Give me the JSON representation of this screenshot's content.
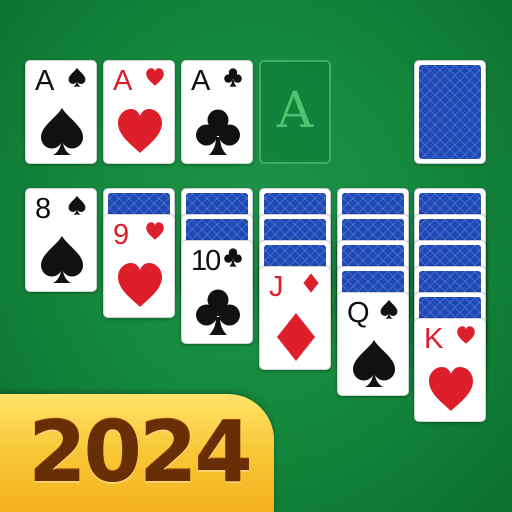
{
  "foundations": [
    {
      "rank": "A",
      "suit": "spade",
      "color": "black"
    },
    {
      "rank": "A",
      "suit": "heart",
      "color": "red"
    },
    {
      "rank": "A",
      "suit": "club",
      "color": "black"
    }
  ],
  "empty_foundation": {
    "label": "A"
  },
  "stock": {
    "state": "face-down"
  },
  "tableau": [
    {
      "face_down": 0,
      "face_up": {
        "rank": "8",
        "suit": "spade",
        "color": "black"
      }
    },
    {
      "face_down": 1,
      "face_up": {
        "rank": "9",
        "suit": "heart",
        "color": "red"
      }
    },
    {
      "face_down": 2,
      "face_up": {
        "rank": "10",
        "suit": "club",
        "color": "black"
      }
    },
    {
      "face_down": 3,
      "face_up": {
        "rank": "J",
        "suit": "diamond",
        "color": "red"
      }
    },
    {
      "face_down": 4,
      "face_up": {
        "rank": "Q",
        "suit": "spade",
        "color": "black"
      }
    },
    {
      "face_down": 5,
      "face_up": {
        "rank": "K",
        "suit": "heart",
        "color": "red"
      }
    }
  ],
  "banner": {
    "year": "2024"
  },
  "colors": {
    "felt": "#158a3e",
    "card_back": "#1e49b7",
    "red_suit": "#dc1f2b",
    "black_suit": "#111111",
    "banner_gold": "#f9c736",
    "banner_text": "#6a2e06"
  }
}
